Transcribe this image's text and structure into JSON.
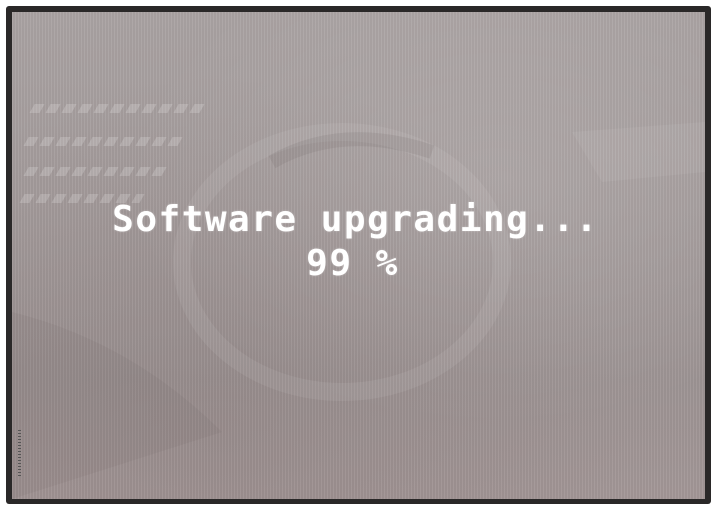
{
  "screen": {
    "status_message": "Software upgrading...",
    "progress_percent": 99,
    "progress_label": "99 %",
    "text_color": "#ffffff",
    "background_color": "#a59d9d"
  }
}
